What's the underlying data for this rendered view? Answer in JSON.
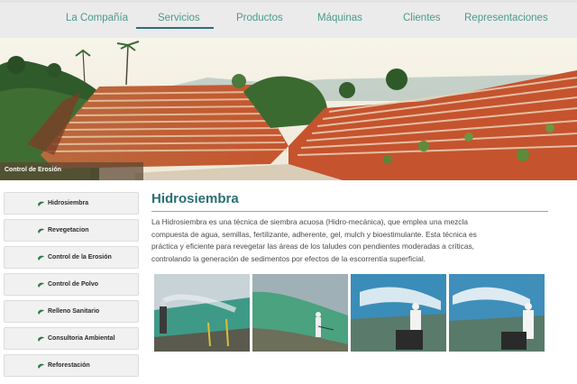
{
  "nav": {
    "items": [
      {
        "label": "La Compañía"
      },
      {
        "label": "Servicios"
      },
      {
        "label": "Productos"
      },
      {
        "label": "Máquinas"
      },
      {
        "label": "Clientes"
      },
      {
        "label": "Representaciones"
      }
    ],
    "active_index": 1
  },
  "hero": {
    "caption": "Control de Erosión"
  },
  "sidebar": {
    "items": [
      {
        "label": "Hidrosiembra",
        "icon": "leaf-icon"
      },
      {
        "label": "Revegetacion",
        "icon": "leaf-icon"
      },
      {
        "label": "Control de la Erosión",
        "icon": "leaf-icon"
      },
      {
        "label": "Control de Polvo",
        "icon": "leaf-icon"
      },
      {
        "label": "Relleno Sanitario",
        "icon": "leaf-icon"
      },
      {
        "label": "Consultoria Ambiental",
        "icon": "leaf-icon"
      },
      {
        "label": "Reforestación",
        "icon": "leaf-icon"
      }
    ]
  },
  "main": {
    "title": "Hidrosiembra",
    "lines": [
      "La Hidrosiembra es una técnica de siembra acuosa (Hidro-mecánica), que emplea una mezcla",
      "compuesta de agua, semillas, fertilizante, adherente, gel, mulch y bioestimulante. Esta técnica es",
      "práctica y eficiente para revegetar las áreas de los taludes con pendientes moderadas a críticas,",
      "controlando la generación de sedimentos por efectos de la escorrentía superficial."
    ]
  },
  "gallery": {
    "photos": [
      {
        "subject": "worker-spraying-slope"
      },
      {
        "subject": "worker-on-green-slope"
      },
      {
        "subject": "hydroseeder-spray"
      },
      {
        "subject": "hydroseeder-spray-operator"
      }
    ]
  },
  "colors": {
    "nav_text": "#4a9a8c",
    "nav_active_line": "#2f6d78",
    "title": "#2a6f72",
    "leaf": "#2f7a4a"
  }
}
